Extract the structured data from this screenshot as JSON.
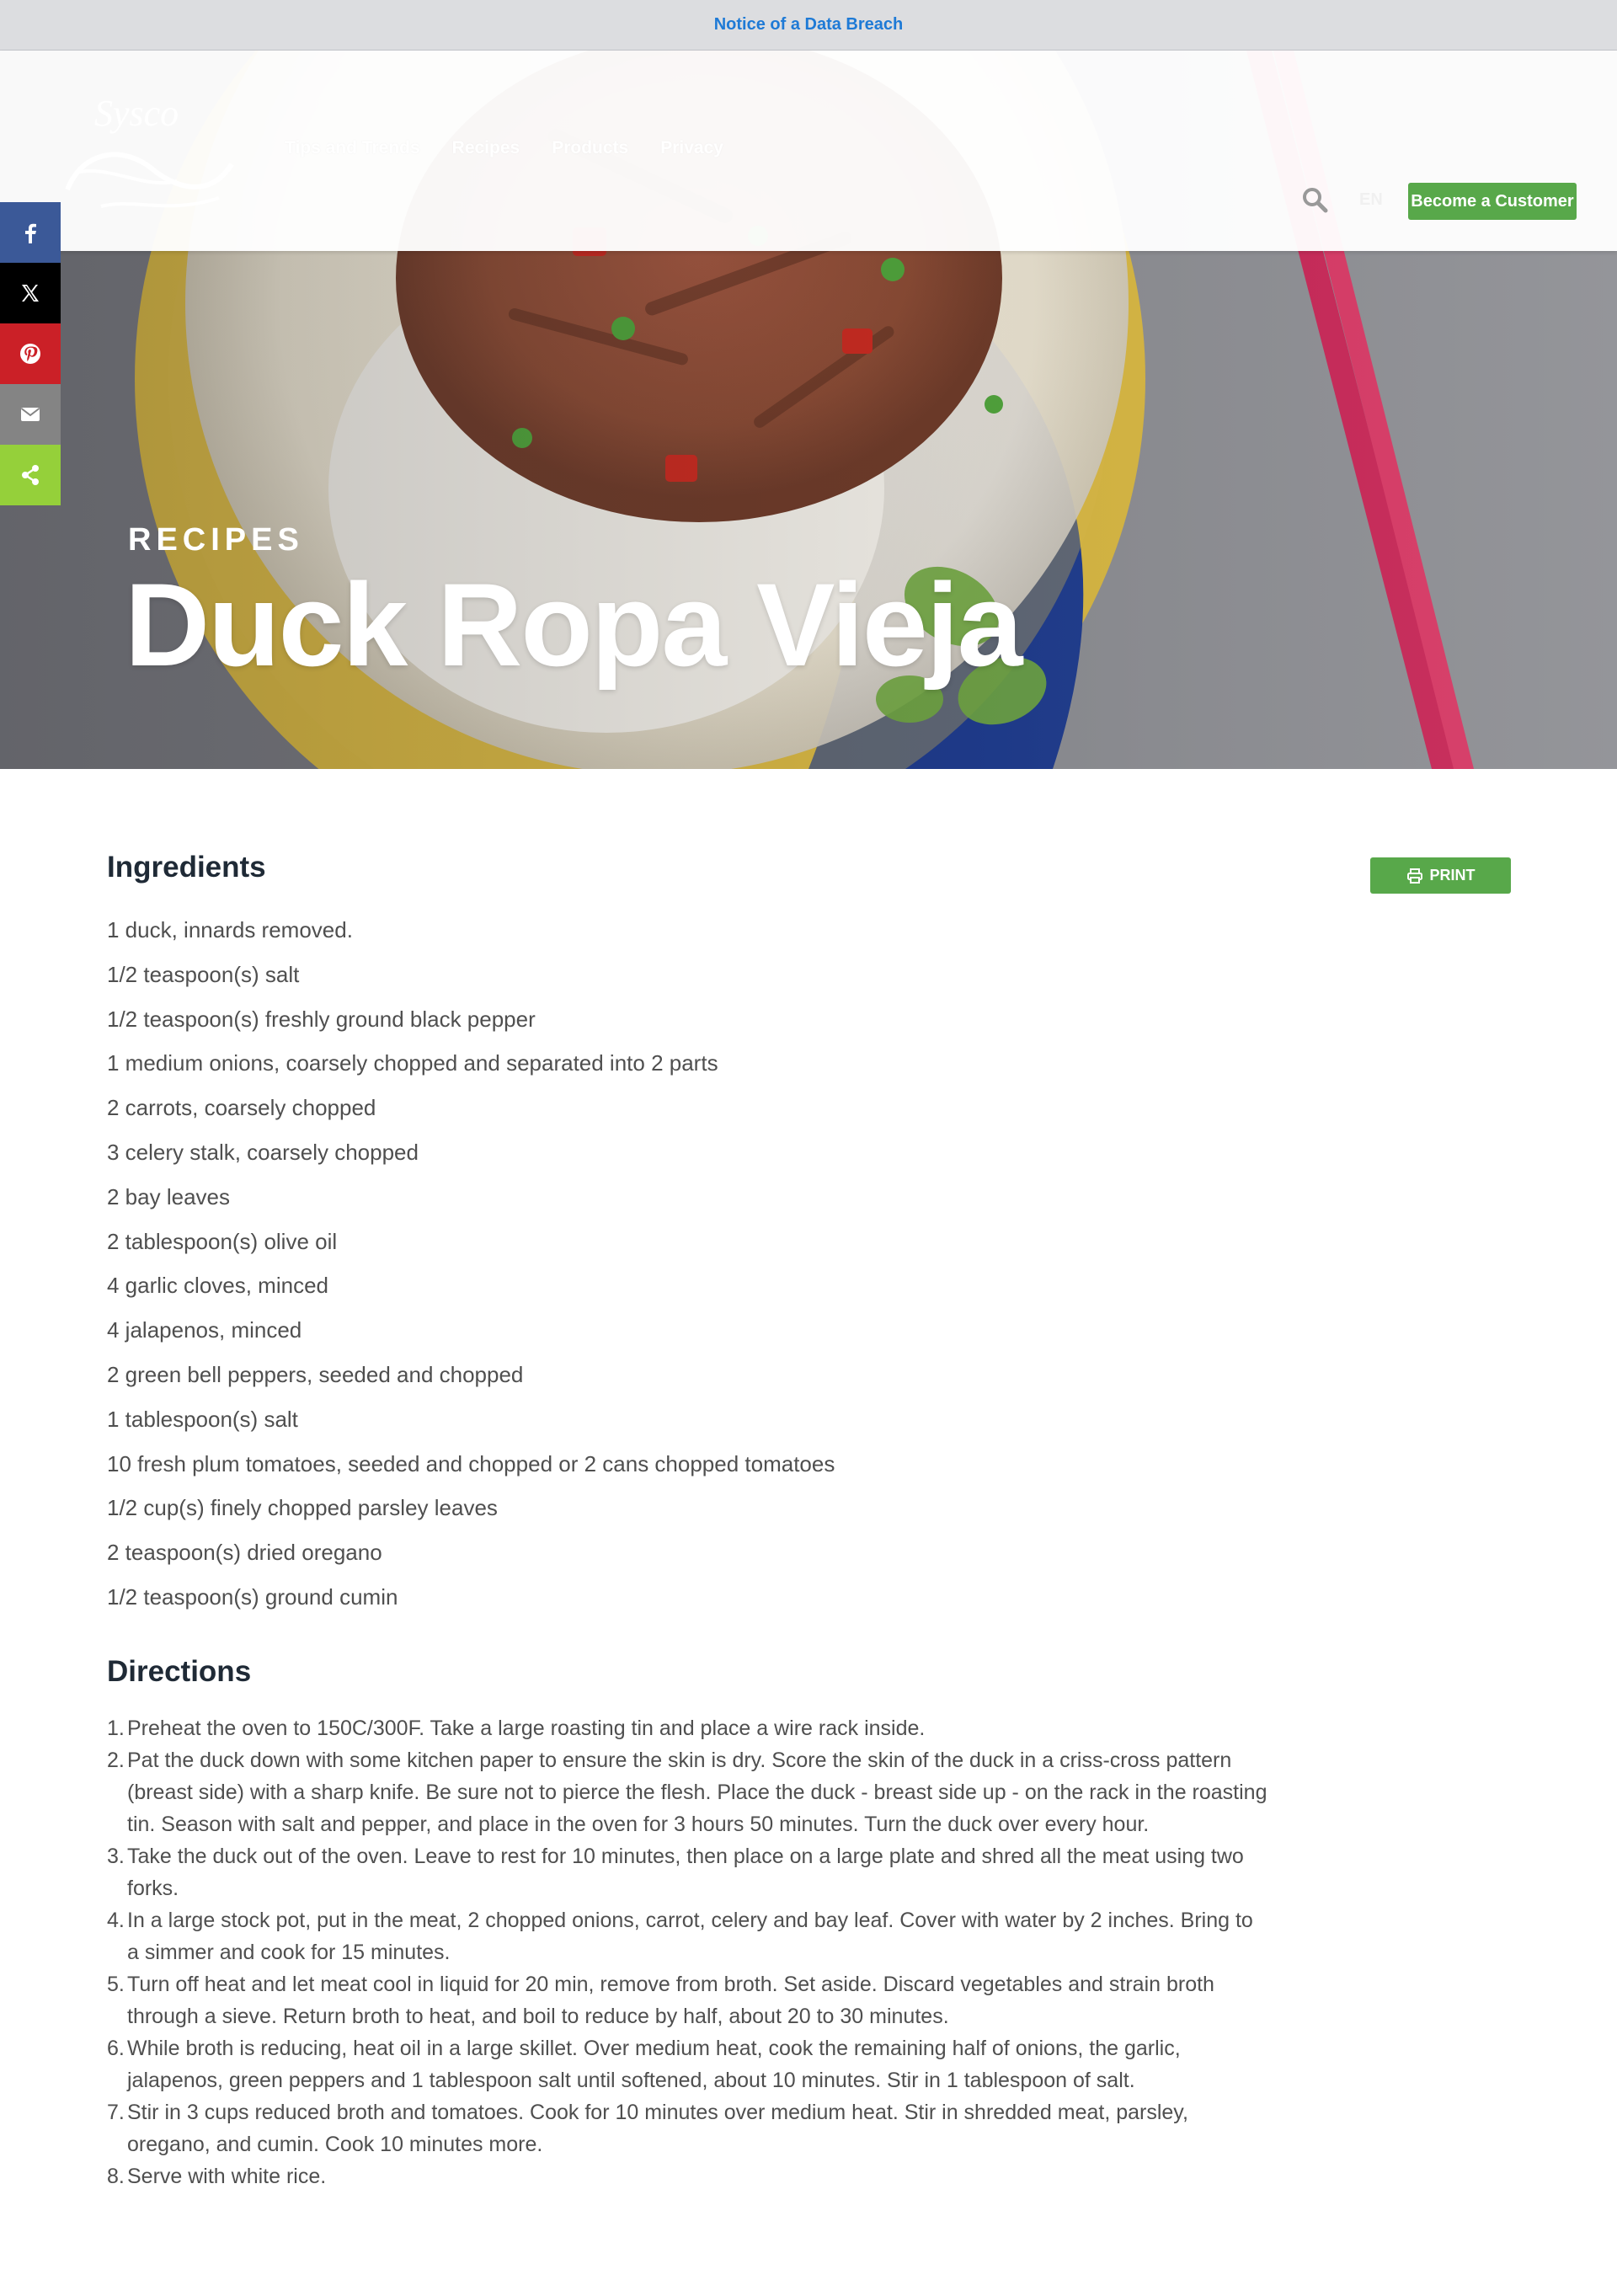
{
  "notice": {
    "text": "Notice of a Data Breach"
  },
  "header": {
    "logo_text": "Sysco",
    "nav": [
      "Tips and Trends",
      "Recipes",
      "Products",
      "Privacy"
    ],
    "lang": "EN",
    "cta": "Become a Customer"
  },
  "hero": {
    "eyebrow": "RECIPES",
    "title": "Duck Ropa Vieja"
  },
  "share": {
    "icons": [
      "facebook-icon",
      "x-twitter-icon",
      "pinterest-icon",
      "email-icon",
      "share-icon"
    ]
  },
  "colors": {
    "brand_green": "#58a84a",
    "notice_link": "#1e7ad6",
    "heading": "#1f2a36",
    "body_text": "#4f4f4f"
  },
  "main": {
    "ingredients_heading": "Ingredients",
    "print_label": "PRINT",
    "ingredients": [
      "1 duck, innards removed.",
      "1/2 teaspoon(s) salt",
      "1/2 teaspoon(s) freshly ground black pepper",
      "1 medium onions, coarsely chopped and separated into 2 parts",
      "2 carrots, coarsely chopped",
      "3 celery stalk, coarsely chopped",
      "2 bay leaves",
      "2 tablespoon(s) olive oil",
      "4 garlic cloves, minced",
      "4 jalapenos, minced",
      "2 green bell peppers, seeded and chopped",
      "1 tablespoon(s) salt",
      "10 fresh plum tomatoes, seeded and chopped or 2 cans chopped tomatoes",
      "1/2 cup(s) finely chopped parsley leaves",
      "2 teaspoon(s) dried oregano",
      "1/2 teaspoon(s) ground cumin"
    ],
    "directions_heading": "Directions",
    "directions": [
      {
        "num": "1.",
        "text": "Preheat the oven to 150C/300F. Take a large roasting tin and place a wire rack inside."
      },
      {
        "num": "2.",
        "text": "Pat the duck down with some kitchen paper to ensure the skin is dry. Score the skin of the duck in a criss-cross pattern (breast side) with a sharp knife. Be sure not to pierce the flesh. Place the duck - breast side up - on the rack in the roasting tin. Season with salt and pepper, and place in the oven for 3 hours 50 minutes. Turn the duck over every hour."
      },
      {
        "num": "3.",
        "text": "Take the duck out of the oven. Leave to rest for 10 minutes, then place on a large plate and shred all the meat using two forks."
      },
      {
        "num": "4.",
        "text": "In a large stock pot, put in the meat, 2 chopped onions, carrot, celery and bay leaf. Cover with water by 2 inches. Bring to a simmer and cook for 15 minutes."
      },
      {
        "num": "5.",
        "text": "Turn off heat and let meat cool in liquid for 20 min, remove from broth. Set aside. Discard vegetables and strain broth through a sieve. Return broth to heat, and boil to reduce by half, about 20 to 30 minutes."
      },
      {
        "num": "6.",
        "text": "While broth is reducing, heat oil in a large skillet. Over medium heat, cook the remaining half of onions, the garlic, jalapenos, green peppers and 1 tablespoon salt until softened, about 10 minutes. Stir in 1 tablespoon of salt."
      },
      {
        "num": "7.",
        "text": "Stir in 3 cups reduced broth and tomatoes. Cook for 10 minutes over medium heat. Stir in shredded meat, parsley, oregano, and cumin. Cook 10 minutes more."
      },
      {
        "num": "8.",
        "text": "Serve with white rice."
      }
    ]
  }
}
